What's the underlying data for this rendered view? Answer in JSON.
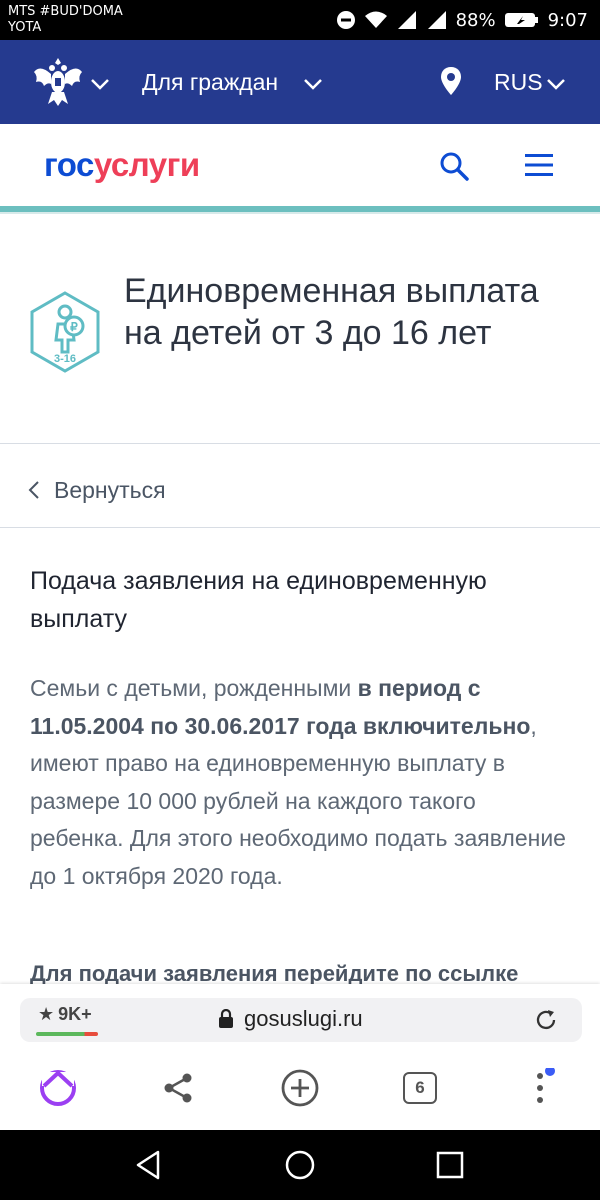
{
  "status_bar": {
    "carrier_line1": "MTS #BUD'DOMA",
    "carrier_line2": "YOTA",
    "battery": "88%",
    "time": "9:07"
  },
  "top_nav": {
    "citizens_label": "Для граждан",
    "language": "RUS",
    "bg_color": "#253a8f"
  },
  "header": {
    "logo_part1": "гос",
    "logo_part2": "услуги",
    "logo_colors": [
      "#0d4cd3",
      "#ee3f58"
    ]
  },
  "page": {
    "icon_label": "3-16",
    "title": "Единовременная выплата на детей от 3 до 16 лет",
    "back_label": "Вернуться",
    "section_title": "Подача заявления на единовременную выплату",
    "paragraph": {
      "part1": "Семьи с детьми, рожденными ",
      "bold": "в период с 11.05.2004 по 30.06.2017 года включительно",
      "part2": ", имеют право на единовременную выплату в размере 10 000 рублей на каждого такого ребенка. Для этого необходимо подать заявление до 1 октября 2020 года."
    },
    "cutoff_line": "Для подачи заявления перейдите по ссылке"
  },
  "browser": {
    "rating": "9K+",
    "url": "gosuslugi.ru",
    "tabs_count": "6"
  }
}
